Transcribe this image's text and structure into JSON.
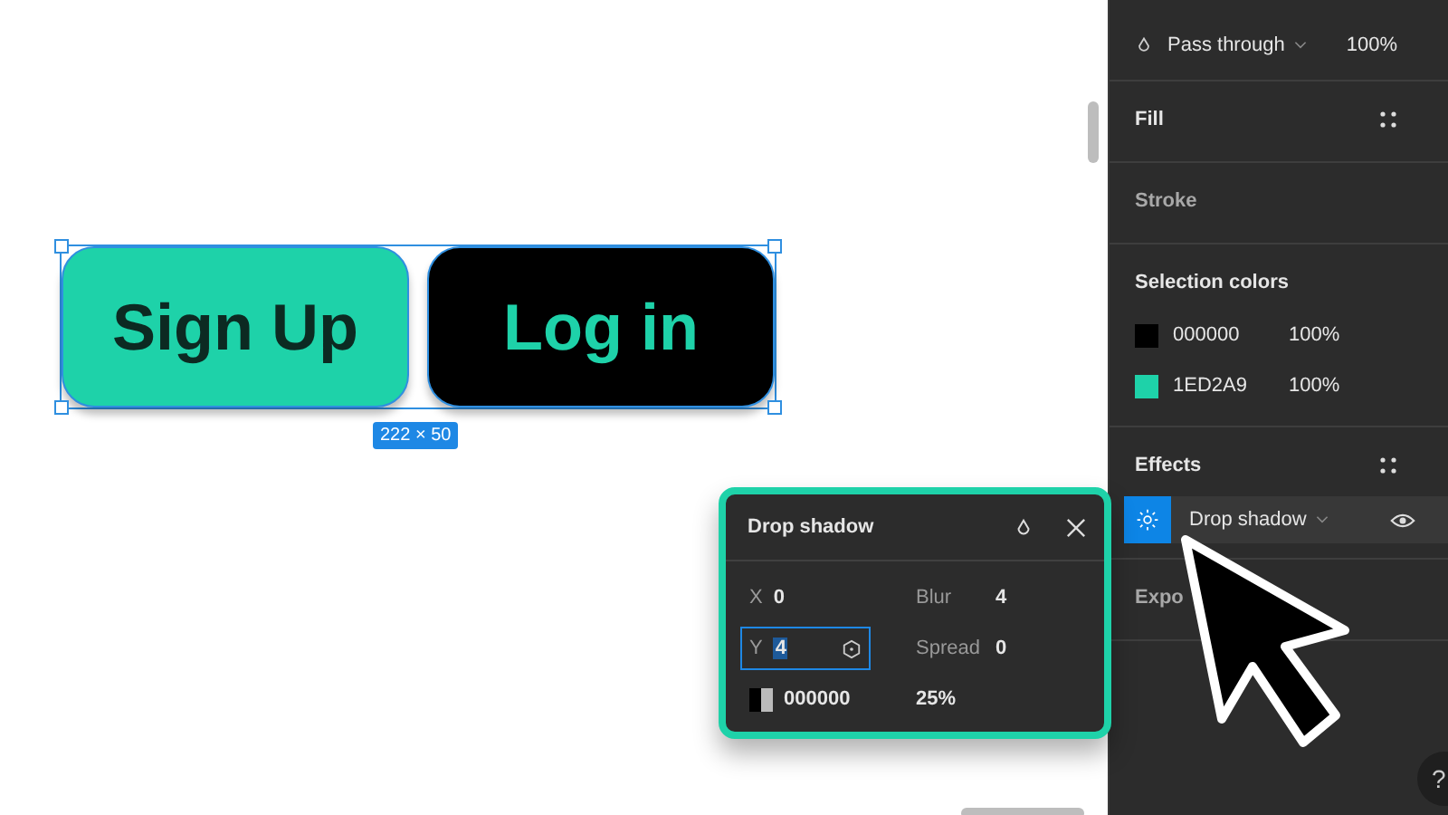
{
  "canvas": {
    "buttons": [
      {
        "label": "Sign Up",
        "kind": "primary"
      },
      {
        "label": "Log in",
        "kind": "secondary"
      }
    ],
    "size_badge": "222 × 50"
  },
  "drop_shadow_popup": {
    "title": "Drop shadow",
    "fields": [
      {
        "label": "X",
        "value": "0",
        "selected": false
      },
      {
        "label": "Blur",
        "value": "4",
        "selected": false
      },
      {
        "label": "Y",
        "value": "4",
        "selected": true
      },
      {
        "label": "Spread",
        "value": "0",
        "selected": false
      }
    ],
    "hex": "000000",
    "opacity": "25%"
  },
  "panel": {
    "layer": {
      "blend": "Pass through",
      "opacity": "100%"
    },
    "fill": {
      "title": "Fill"
    },
    "stroke": {
      "title": "Stroke"
    },
    "selection_colors": {
      "title": "Selection colors",
      "colors": [
        {
          "hex": "000000",
          "opacity": "100%",
          "color": "#000000"
        },
        {
          "hex": "1ED2A9",
          "opacity": "100%",
          "color": "#1ed2a9"
        }
      ]
    },
    "effects": {
      "title": "Effects",
      "items": [
        {
          "name": "Drop shadow",
          "visible": true,
          "selected": true
        }
      ]
    },
    "export": {
      "title": "Expo"
    }
  },
  "help": "?"
}
